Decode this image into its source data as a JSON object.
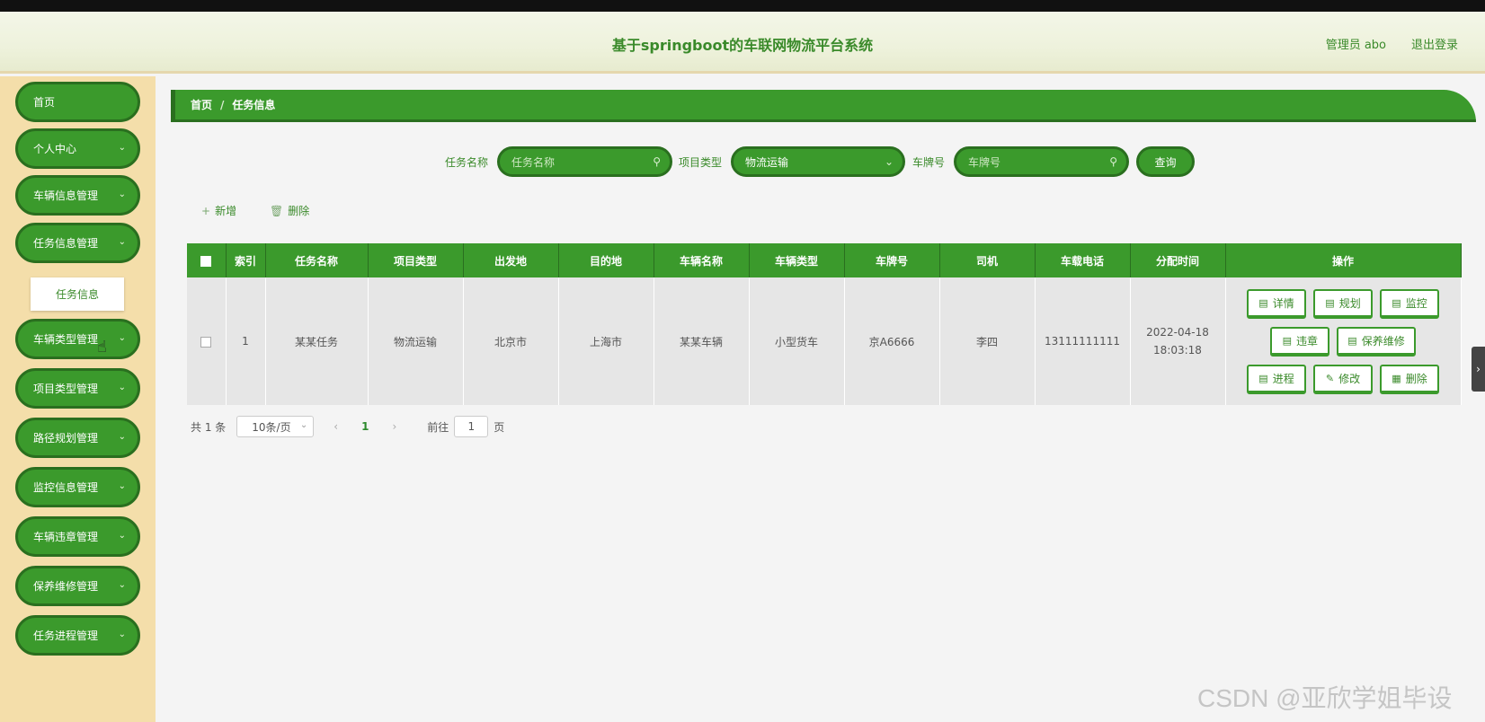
{
  "header": {
    "title": "基于springboot的车联网物流平台系统",
    "user": "管理员 abo",
    "logout": "退出登录"
  },
  "sidebar": {
    "items": [
      {
        "label": "首页",
        "has_chevron": false
      },
      {
        "label": "个人中心",
        "has_chevron": true
      },
      {
        "label": "车辆信息管理",
        "has_chevron": true
      },
      {
        "label": "任务信息管理",
        "has_chevron": true
      },
      {
        "label": "车辆类型管理",
        "has_chevron": true
      },
      {
        "label": "项目类型管理",
        "has_chevron": true
      },
      {
        "label": "路径规划管理",
        "has_chevron": true
      },
      {
        "label": "监控信息管理",
        "has_chevron": true
      },
      {
        "label": "车辆违章管理",
        "has_chevron": true
      },
      {
        "label": "保养维修管理",
        "has_chevron": true
      },
      {
        "label": "任务进程管理",
        "has_chevron": true
      }
    ],
    "submenu_label": "任务信息"
  },
  "breadcrumb": {
    "home": "首页",
    "separator": "/",
    "current": "任务信息"
  },
  "search": {
    "task_name_label": "任务名称",
    "task_name_placeholder": "任务名称",
    "project_type_label": "项目类型",
    "project_type_value": "物流运输",
    "plate_label": "车牌号",
    "plate_placeholder": "车牌号",
    "query_button": "查询"
  },
  "actions": {
    "add": "新增",
    "delete": "删除"
  },
  "table": {
    "headers": [
      "索引",
      "任务名称",
      "项目类型",
      "出发地",
      "目的地",
      "车辆名称",
      "车辆类型",
      "车牌号",
      "司机",
      "车载电话",
      "分配时间",
      "操作"
    ],
    "rows": [
      {
        "index": "1",
        "task_name": "某某任务",
        "project_type": "物流运输",
        "origin": "北京市",
        "destination": "上海市",
        "vehicle_name": "某某车辆",
        "vehicle_type": "小型货车",
        "plate": "京A6666",
        "driver": "李四",
        "phone": "13111111111",
        "assign_time": "2022-04-18 18:03:18"
      }
    ],
    "op_buttons": {
      "detail": "详情",
      "plan": "规划",
      "monitor": "监控",
      "violation": "违章",
      "maintenance": "保养维修",
      "progress": "进程",
      "edit": "修改",
      "delete": "删除"
    }
  },
  "pager": {
    "total": "共 1 条",
    "page_size": "10条/页",
    "current_page": "1",
    "goto_label": "前往",
    "goto_value": "1",
    "page_unit": "页"
  },
  "watermark": "CSDN @亚欣学姐毕设",
  "colors": {
    "primary": "#3b9a2c",
    "primary_dark": "#2a6f1f",
    "sidebar_bg": "#f4deaa",
    "text_green": "#3a8a2a"
  }
}
